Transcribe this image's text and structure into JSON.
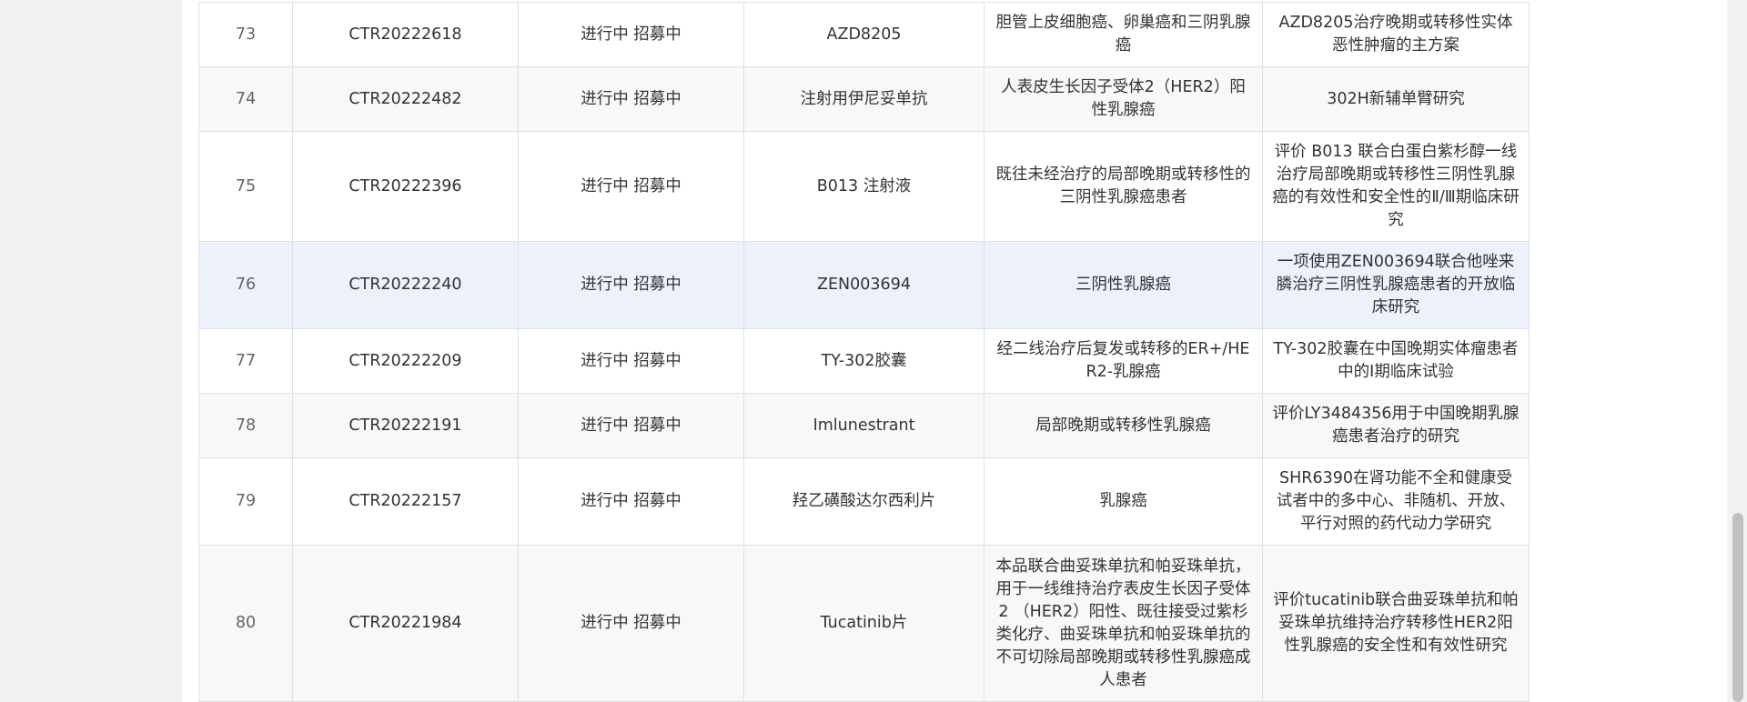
{
  "table": {
    "rows": [
      {
        "num": "73",
        "reg": "CTR20222618",
        "status": "进行中 招募中",
        "drug": "AZD8205",
        "indication": "胆管上皮细胞癌、卵巢癌和三阴乳腺癌",
        "title": "AZD8205治疗晚期或转移性实体恶性肿瘤的主方案"
      },
      {
        "num": "74",
        "reg": "CTR20222482",
        "status": "进行中 招募中",
        "drug": "注射用伊尼妥单抗",
        "indication": "人表皮生长因子受体2（HER2）阳性乳腺癌",
        "title": "302H新辅单臂研究"
      },
      {
        "num": "75",
        "reg": "CTR20222396",
        "status": "进行中 招募中",
        "drug": "B013 注射液",
        "indication": "既往未经治疗的局部晚期或转移性的三阴性乳腺癌患者",
        "title": "评价 B013 联合白蛋白紫杉醇一线治疗局部晚期或转移性三阴性乳腺癌的有效性和安全性的Ⅱ/Ⅲ期临床研究"
      },
      {
        "num": "76",
        "reg": "CTR20222240",
        "status": "进行中 招募中",
        "drug": "ZEN003694",
        "indication": "三阴性乳腺癌",
        "title": "一项使用ZEN003694联合他唑来膦治疗三阴性乳腺癌患者的开放临床研究"
      },
      {
        "num": "77",
        "reg": "CTR20222209",
        "status": "进行中 招募中",
        "drug": "TY-302胶囊",
        "indication": "经二线治疗后复发或转移的ER+/HER2-乳腺癌",
        "title": "TY-302胶囊在中国晚期实体瘤患者中的I期临床试验"
      },
      {
        "num": "78",
        "reg": "CTR20222191",
        "status": "进行中 招募中",
        "drug": "Imlunestrant",
        "indication": "局部晚期或转移性乳腺癌",
        "title": "评价LY3484356用于中国晚期乳腺癌患者治疗的研究"
      },
      {
        "num": "79",
        "reg": "CTR20222157",
        "status": "进行中 招募中",
        "drug": "羟乙磺酸达尔西利片",
        "indication": "乳腺癌",
        "title": "SHR6390在肾功能不全和健康受试者中的多中心、非随机、开放、平行对照的药代动力学研究"
      },
      {
        "num": "80",
        "reg": "CTR20221984",
        "status": "进行中 招募中",
        "drug": "Tucatinib片",
        "indication": "本品联合曲妥珠单抗和帕妥珠单抗，用于一线维持治疗表皮生长因子受体2 （HER2）阳性、既往接受过紫杉类化疗、曲妥珠单抗和帕妥珠单抗的不可切除局部晚期或转移性乳腺癌成人患者",
        "title": "评价tucatinib联合曲妥珠单抗和帕妥珠单抗维持治疗转移性HER2阳性乳腺癌的安全性和有效性研究"
      }
    ]
  }
}
